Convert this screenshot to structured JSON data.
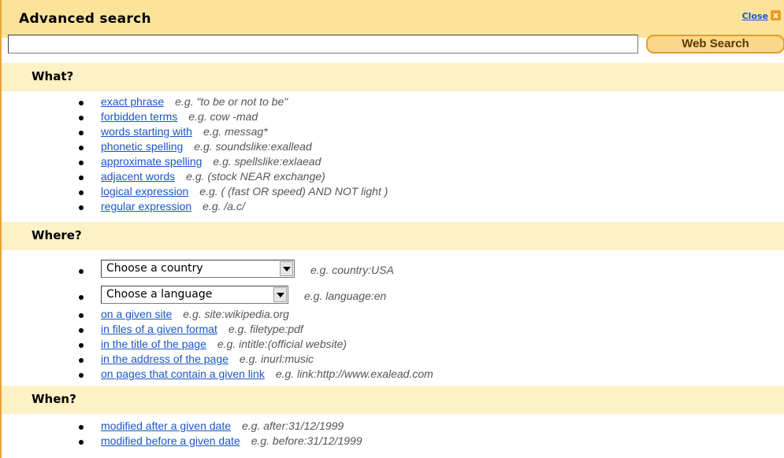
{
  "header": {
    "title": "Advanced search",
    "close_label": "Close",
    "close_icon": "x"
  },
  "search": {
    "value": "",
    "placeholder": "",
    "button_label": "Web Search"
  },
  "sections": {
    "what": {
      "title": "What?",
      "items": [
        {
          "label": "exact phrase",
          "example": "e.g. \"to be or not to be\""
        },
        {
          "label": "forbidden terms",
          "example": "e.g. cow -mad"
        },
        {
          "label": "words starting with",
          "example": "e.g. messag*"
        },
        {
          "label": "phonetic spelling",
          "example": "e.g. soundslike:exallead"
        },
        {
          "label": "approximate spelling",
          "example": "e.g. spellslike:exlaead"
        },
        {
          "label": "adjacent words",
          "example": "e.g. (stock NEAR exchange)"
        },
        {
          "label": "logical expression",
          "example": "e.g. ( (fast OR speed) AND NOT light )"
        },
        {
          "label": "regular expression",
          "example": "e.g. /a.c/"
        }
      ]
    },
    "where": {
      "title": "Where?",
      "selects": [
        {
          "value": "Choose a country",
          "example": "e.g. country:USA"
        },
        {
          "value": "Choose a language",
          "example": "e.g. language:en"
        }
      ],
      "items": [
        {
          "label": "on a given site",
          "example": "e.g. site:wikipedia.org"
        },
        {
          "label": "in files of a given format",
          "example": "e.g. filetype:pdf"
        },
        {
          "label": "in the title of the page",
          "example": "e.g. intitle:(official website)"
        },
        {
          "label": "in the address of the page",
          "example": "e.g. inurl:music"
        },
        {
          "label": "on pages that contain a given link",
          "example": "e.g. link:http://www.exalead.com"
        }
      ]
    },
    "when": {
      "title": "When?",
      "items": [
        {
          "label": "modified after a given date",
          "example": "e.g. after:31/12/1999"
        },
        {
          "label": "modified before a given date",
          "example": "e.g. before:31/12/1999"
        }
      ]
    }
  },
  "colors": {
    "title_bar": "#fbe49a",
    "section_bar": "#fdf1c6",
    "link": "#1a56c9",
    "accent": "#e69a2a"
  }
}
